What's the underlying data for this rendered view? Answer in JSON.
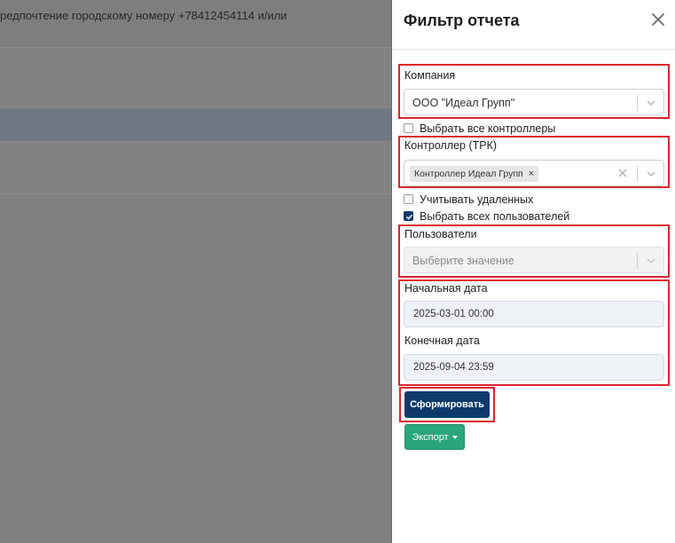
{
  "background": {
    "text": "редпочтение городскому номеру +78412454114 и/или"
  },
  "panel": {
    "title": "Фильтр отчета",
    "company": {
      "label": "Компания",
      "value": "ООО \"Идеал Групп\""
    },
    "select_all_controllers": {
      "label": "Выбрать все контроллеры",
      "checked": false
    },
    "controller": {
      "label": "Контроллер (ТРК)",
      "tag": "Контроллер Идеал Групп",
      "tag_remove": "×"
    },
    "include_deleted": {
      "label": "Учитывать удаленных",
      "checked": false
    },
    "select_all_users": {
      "label": "Выбрать всех пользователей",
      "checked": true
    },
    "users": {
      "label": "Пользователи",
      "placeholder": "Выберите значение"
    },
    "start_date": {
      "label": "Начальная дата",
      "value": "2025-03-01 00:00"
    },
    "end_date": {
      "label": "Конечная дата",
      "value": "2025-09-04 23:59"
    },
    "generate_button": "Сформировать",
    "export_button": "Экспорт"
  },
  "colors": {
    "highlight_border": "#d9262f",
    "primary": "#0c3b6b",
    "export": "#2aa67a"
  }
}
